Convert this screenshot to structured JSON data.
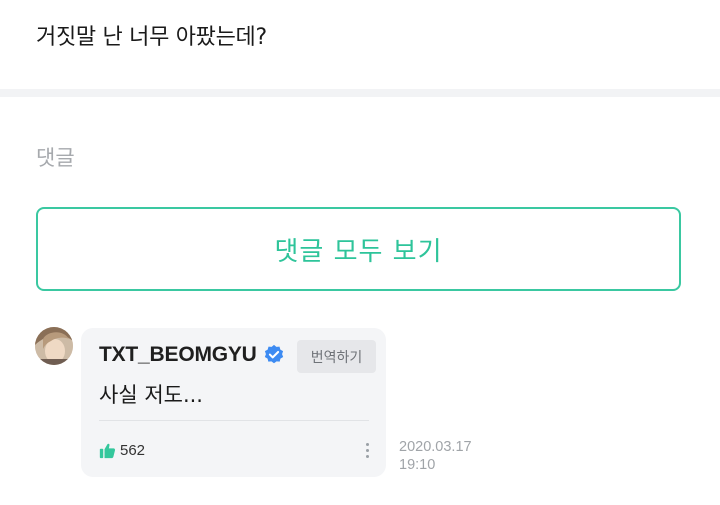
{
  "post": {
    "text": "거짓말 난 너무 아팠는데?"
  },
  "comments_section": {
    "title": "댓글",
    "view_all_label": "댓글 모두 보기"
  },
  "comment": {
    "author": "TXT_BEOMGYU",
    "verified_icon": "verified-check-icon",
    "translate_label": "번역하기",
    "body": "사실 저도...",
    "like_icon": "thumbs-up-icon",
    "like_count": "562",
    "more_icon": "more-vertical-icon",
    "date": "2020.03.17",
    "time": "19:10"
  },
  "colors": {
    "accent": "#2ec49a",
    "verified": "#3d8bf2",
    "like": "#34c79c"
  }
}
